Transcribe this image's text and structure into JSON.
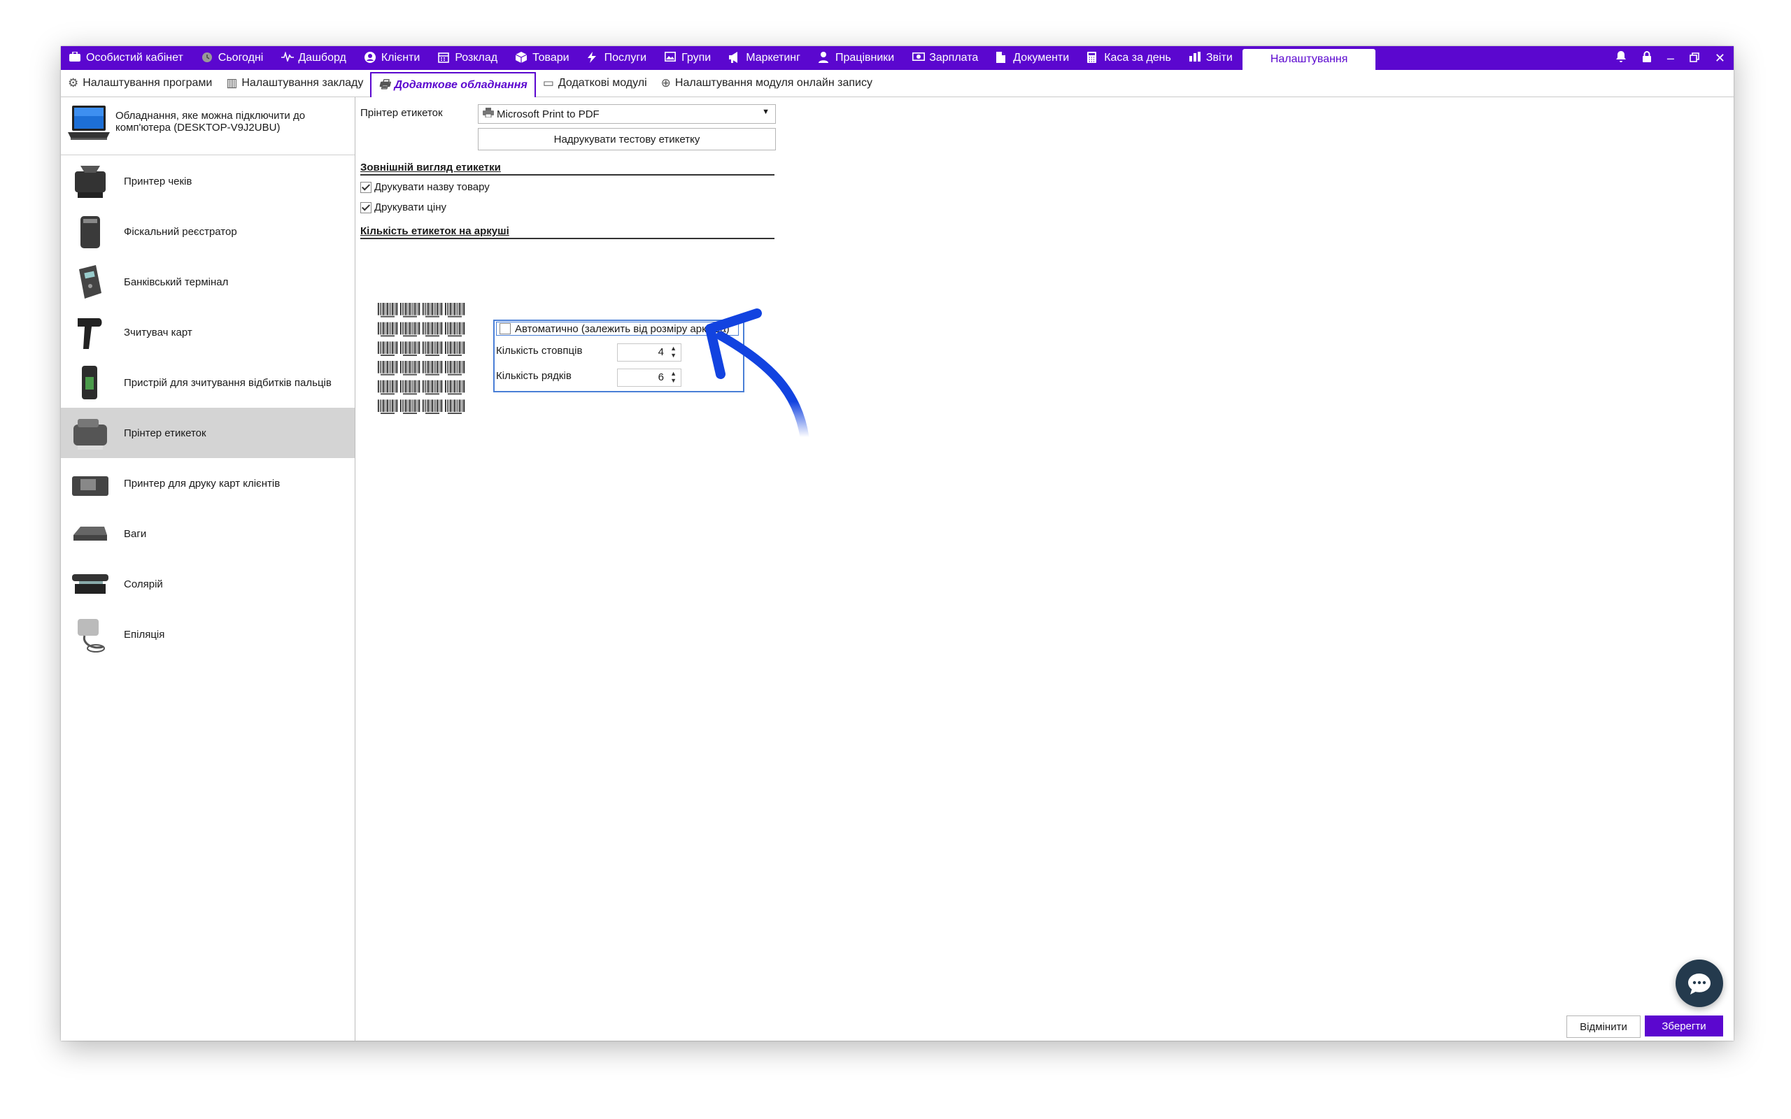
{
  "topnav": {
    "items": [
      {
        "label": "Особистий кабінет",
        "icon": "briefcase-icon"
      },
      {
        "label": "Сьогодні",
        "icon": "clock-icon"
      },
      {
        "label": "Дашборд",
        "icon": "pulse-icon"
      },
      {
        "label": "Клієнти",
        "icon": "user-circle-icon"
      },
      {
        "label": "Розклад",
        "icon": "calendar-icon"
      },
      {
        "label": "Товари",
        "icon": "box-icon"
      },
      {
        "label": "Послуги",
        "icon": "lightning-icon"
      },
      {
        "label": "Групи",
        "icon": "image-icon"
      },
      {
        "label": "Маркетинг",
        "icon": "megaphone-icon"
      },
      {
        "label": "Працівники",
        "icon": "person-icon"
      },
      {
        "label": "Зарплата",
        "icon": "cash-icon"
      },
      {
        "label": "Документи",
        "icon": "document-icon"
      },
      {
        "label": "Каса за день",
        "icon": "calculator-icon"
      },
      {
        "label": "Звіти",
        "icon": "bar-chart-icon"
      }
    ],
    "active_label": "Налаштування"
  },
  "subnav": {
    "items": [
      {
        "label": "Налаштування програми",
        "icon": "gear-icon"
      },
      {
        "label": "Налаштування закладу",
        "icon": "building-icon"
      },
      {
        "label": "Додаткове обладнання",
        "icon": "printer-icon"
      },
      {
        "label": "Додаткові модулі",
        "icon": "window-icon"
      },
      {
        "label": "Налаштування модуля онлайн запису",
        "icon": "globe-icon"
      }
    ],
    "active_index": 2
  },
  "left_panel": {
    "header": "Обладнання, яке можна підключити до комп'ютера (DESKTOP-V9J2UBU)",
    "devices": [
      "Принтер чеків",
      "Фіскальний реєстратор",
      "Банківський термінал",
      "Зчитувач карт",
      "Пристрій для зчитування відбитків пальців",
      "Прінтер етикеток",
      "Принтер для друку карт клієнтів",
      "Ваги",
      "Солярій",
      "Епіляція"
    ],
    "selected_index": 5
  },
  "main": {
    "printer_label": "Прінтер етикеток",
    "printer_value": "Microsoft Print to PDF",
    "test_button": "Надрукувати тестову етикетку",
    "appearance_title": "Зовнішній вигляд етикетки",
    "print_name_label": "Друкувати назву товару",
    "print_name_checked": true,
    "print_price_label": "Друкувати ціну",
    "print_price_checked": true,
    "count_title": "Кількість етикеток на аркуші",
    "auto_label": "Автоматично (залежить від розміру аркуша)",
    "auto_checked": false,
    "columns_label": "Кількість стовпців",
    "columns_value": "4",
    "rows_label": "Кількість рядків",
    "rows_value": "6"
  },
  "footer": {
    "cancel_label": "Відмінити",
    "save_label": "Зберегти"
  },
  "colors": {
    "accent": "#5b07cf",
    "arrow": "#1243e0",
    "chat": "#243a4d"
  }
}
